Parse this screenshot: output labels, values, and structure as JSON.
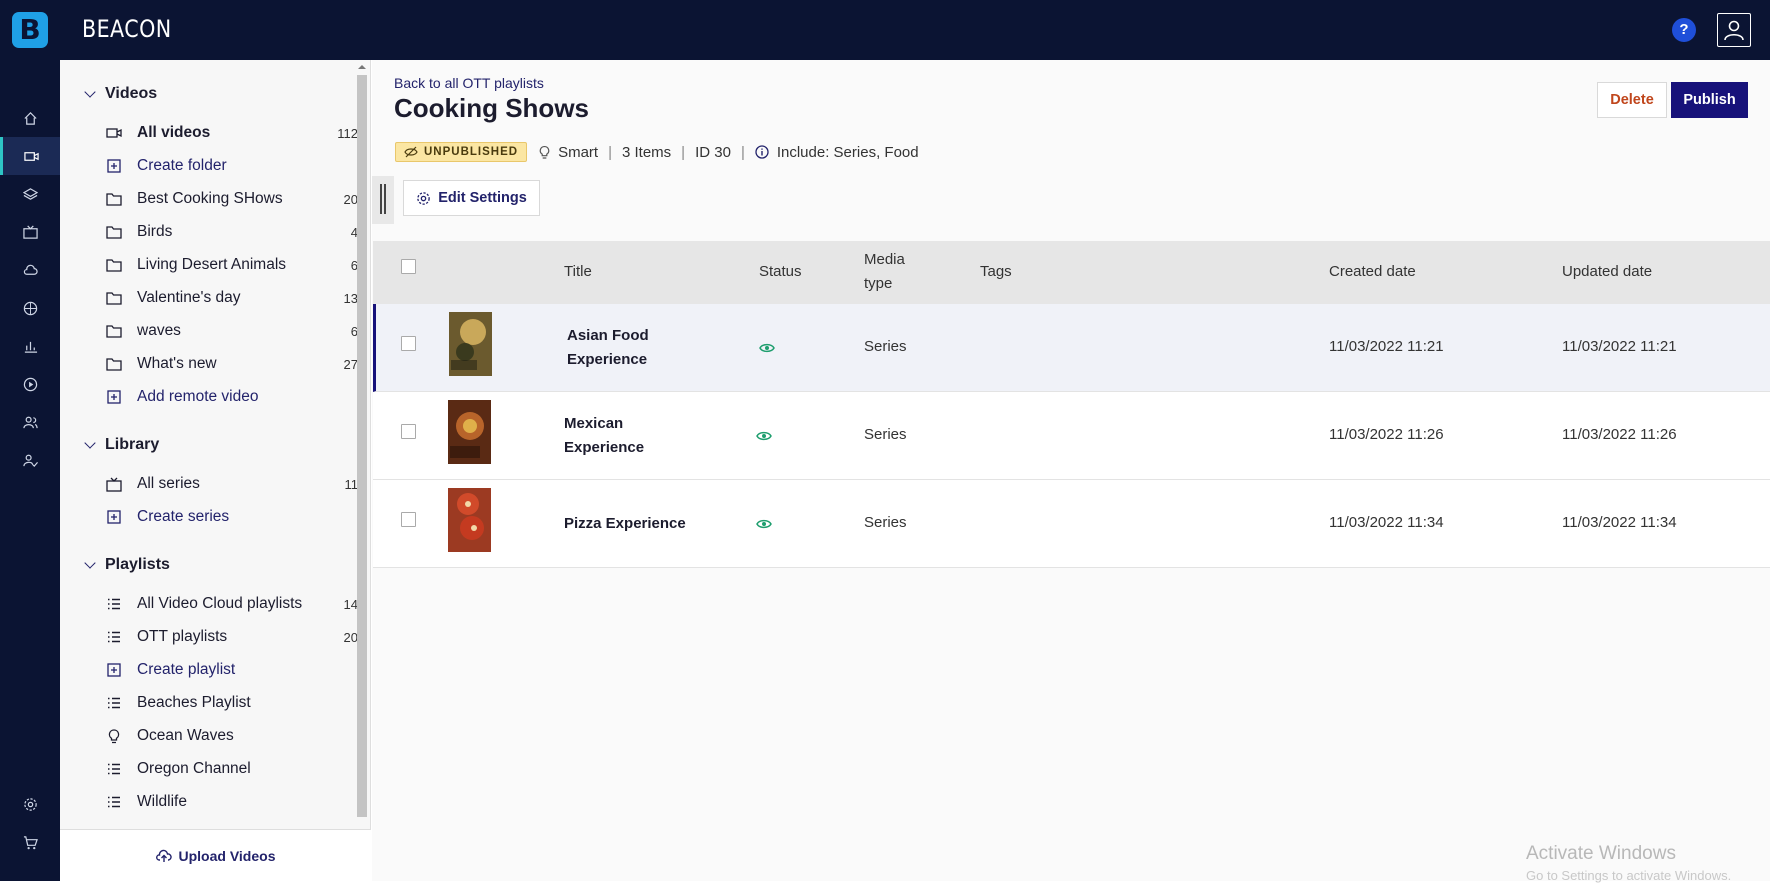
{
  "app": {
    "brand": "BEACON",
    "logo_letter": "B",
    "help_label": "?"
  },
  "rail": {
    "icons": [
      "home-icon",
      "video-icon",
      "layers-icon",
      "tv-icon",
      "cloud-icon",
      "globe-icon",
      "analytics-icon",
      "play-icon",
      "users-icon",
      "user-check-icon",
      "settings-icon",
      "cart-icon"
    ],
    "active": "video-icon"
  },
  "sidebar": {
    "videos": {
      "title": "Videos",
      "items": [
        {
          "label": "All videos",
          "count": "112",
          "icon": "video-icon"
        },
        {
          "label": "Create folder",
          "count": "",
          "icon": "plus-square-icon"
        },
        {
          "label": "Best Cooking SHows",
          "count": "20",
          "icon": "folder-icon"
        },
        {
          "label": "Birds",
          "count": "4",
          "icon": "folder-icon"
        },
        {
          "label": "Living Desert Animals",
          "count": "6",
          "icon": "folder-icon"
        },
        {
          "label": "Valentine's day",
          "count": "13",
          "icon": "folder-icon"
        },
        {
          "label": "waves",
          "count": "6",
          "icon": "folder-icon"
        },
        {
          "label": "What's new",
          "count": "27",
          "icon": "folder-icon"
        },
        {
          "label": "Add remote video",
          "count": "",
          "icon": "plus-square-icon"
        }
      ]
    },
    "library": {
      "title": "Library",
      "items": [
        {
          "label": "All series",
          "count": "11",
          "icon": "tv-icon"
        },
        {
          "label": "Create series",
          "count": "",
          "icon": "plus-square-icon"
        }
      ]
    },
    "playlists": {
      "title": "Playlists",
      "items": [
        {
          "label": "All Video Cloud playlists",
          "count": "14",
          "icon": "list-icon"
        },
        {
          "label": "OTT playlists",
          "count": "20",
          "icon": "list-icon"
        },
        {
          "label": "Create playlist",
          "count": "",
          "icon": "plus-square-icon"
        },
        {
          "label": "Beaches Playlist",
          "count": "",
          "icon": "list-icon"
        },
        {
          "label": "Ocean Waves",
          "count": "",
          "icon": "bulb-icon"
        },
        {
          "label": "Oregon Channel",
          "count": "",
          "icon": "list-icon"
        },
        {
          "label": "Wildlife",
          "count": "",
          "icon": "list-icon"
        }
      ]
    },
    "upload_label": "Upload Videos"
  },
  "header": {
    "back_link": "Back to all OTT playlists",
    "title": "Cooking Shows",
    "delete_label": "Delete",
    "publish_label": "Publish",
    "status_badge": "UNPUBLISHED",
    "type": "Smart",
    "items": "3 Items",
    "id": "ID 30",
    "include": "Include: Series, Food",
    "edit_settings_label": "Edit Settings"
  },
  "table": {
    "columns": {
      "title": "Title",
      "status": "Status",
      "media_type_1": "Media",
      "media_type_2": "type",
      "tags": "Tags",
      "created": "Created date",
      "updated": "Updated date"
    },
    "rows": [
      {
        "title_1": "Asian Food",
        "title_2": "Experience",
        "media_type": "Series",
        "tags": "",
        "created": "11/03/2022 11:21",
        "updated": "11/03/2022 11:21",
        "thumb_color": "#6b5a2e"
      },
      {
        "title_1": "Mexican",
        "title_2": "Experience",
        "media_type": "Series",
        "tags": "",
        "created": "11/03/2022 11:26",
        "updated": "11/03/2022 11:26",
        "thumb_color": "#5a2a14"
      },
      {
        "title_1": "Pizza Experience",
        "title_2": "",
        "media_type": "Series",
        "tags": "",
        "created": "11/03/2022 11:34",
        "updated": "11/03/2022 11:34",
        "thumb_color": "#9c3a22"
      }
    ]
  },
  "os": {
    "watermark_1": "Activate Windows",
    "watermark_2": "Go to Settings to activate Windows."
  },
  "colors": {
    "topbar": "#0b1433",
    "accent": "#17127a",
    "badge": "#fbe6a3",
    "status_visible": "#1e9e6e",
    "delete": "#c0461c"
  }
}
